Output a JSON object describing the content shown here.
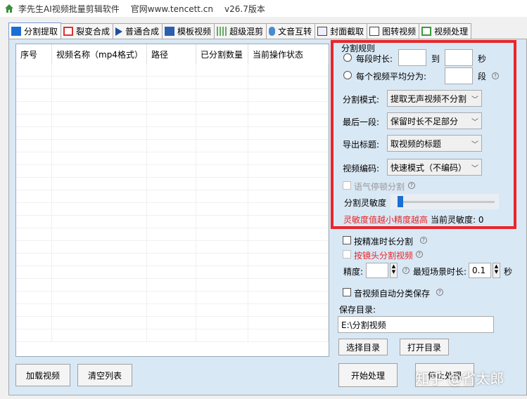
{
  "titlebar": {
    "app_name": "李先生AI视频批量剪辑软件",
    "website": "官网www.tencett.cn",
    "version": "v26.7版本"
  },
  "tabs": [
    {
      "label": "分割提取"
    },
    {
      "label": "裂变合成"
    },
    {
      "label": "普通合成"
    },
    {
      "label": "模板视频"
    },
    {
      "label": "超级混剪"
    },
    {
      "label": "文音互转"
    },
    {
      "label": "封面截取"
    },
    {
      "label": "图转视频"
    },
    {
      "label": "视频处理"
    }
  ],
  "table": {
    "columns": [
      "序号",
      "视频名称（mp4格式）",
      "路径",
      "已分割数量",
      "当前操作状态"
    ]
  },
  "buttons": {
    "load": "加载视频",
    "clear": "清空列表",
    "choose_dir": "选择目录",
    "open_dir": "打开目录",
    "start": "开始处理",
    "stop": "停止处理"
  },
  "rules": {
    "title": "分割规则",
    "per_segment": "每段时长:",
    "to": "到",
    "seconds": "秒",
    "avg_split": "每个视频平均分为:",
    "segments": "段",
    "split_mode_label": "分割模式:",
    "split_mode_value": "提取无声视频不分割",
    "last_segment_label": "最后一段:",
    "last_segment_value": "保留时长不足部分",
    "export_title_label": "导出标题:",
    "export_title_value": "取视频的标题",
    "encoding_label": "视频编码:",
    "encoding_value": "快速模式（不编码）",
    "pause_split": "语气停顿分割",
    "sensitivity_label": "分割灵敏度",
    "sensitivity_note": "灵敏度值越小精度越高",
    "current_sensitivity": "当前灵敏度: 0",
    "sensitivity_value": 0
  },
  "extra": {
    "precise_split": "按精准时长分割",
    "shot_split": "按镜头分割视频",
    "precision_label": "精度:",
    "min_scene_label": "最短场景时长:",
    "min_scene_value": "0.1",
    "seconds": "秒",
    "auto_classify": "音视频自动分类保存",
    "save_dir_label": "保存目录:",
    "save_dir_value": "E:\\分割视频"
  },
  "watermark": "知乎 @省太郎",
  "colors": {
    "accent_red": "#e8262a",
    "panel_bg": "#d9e8f5",
    "note_red": "#e8262a"
  }
}
